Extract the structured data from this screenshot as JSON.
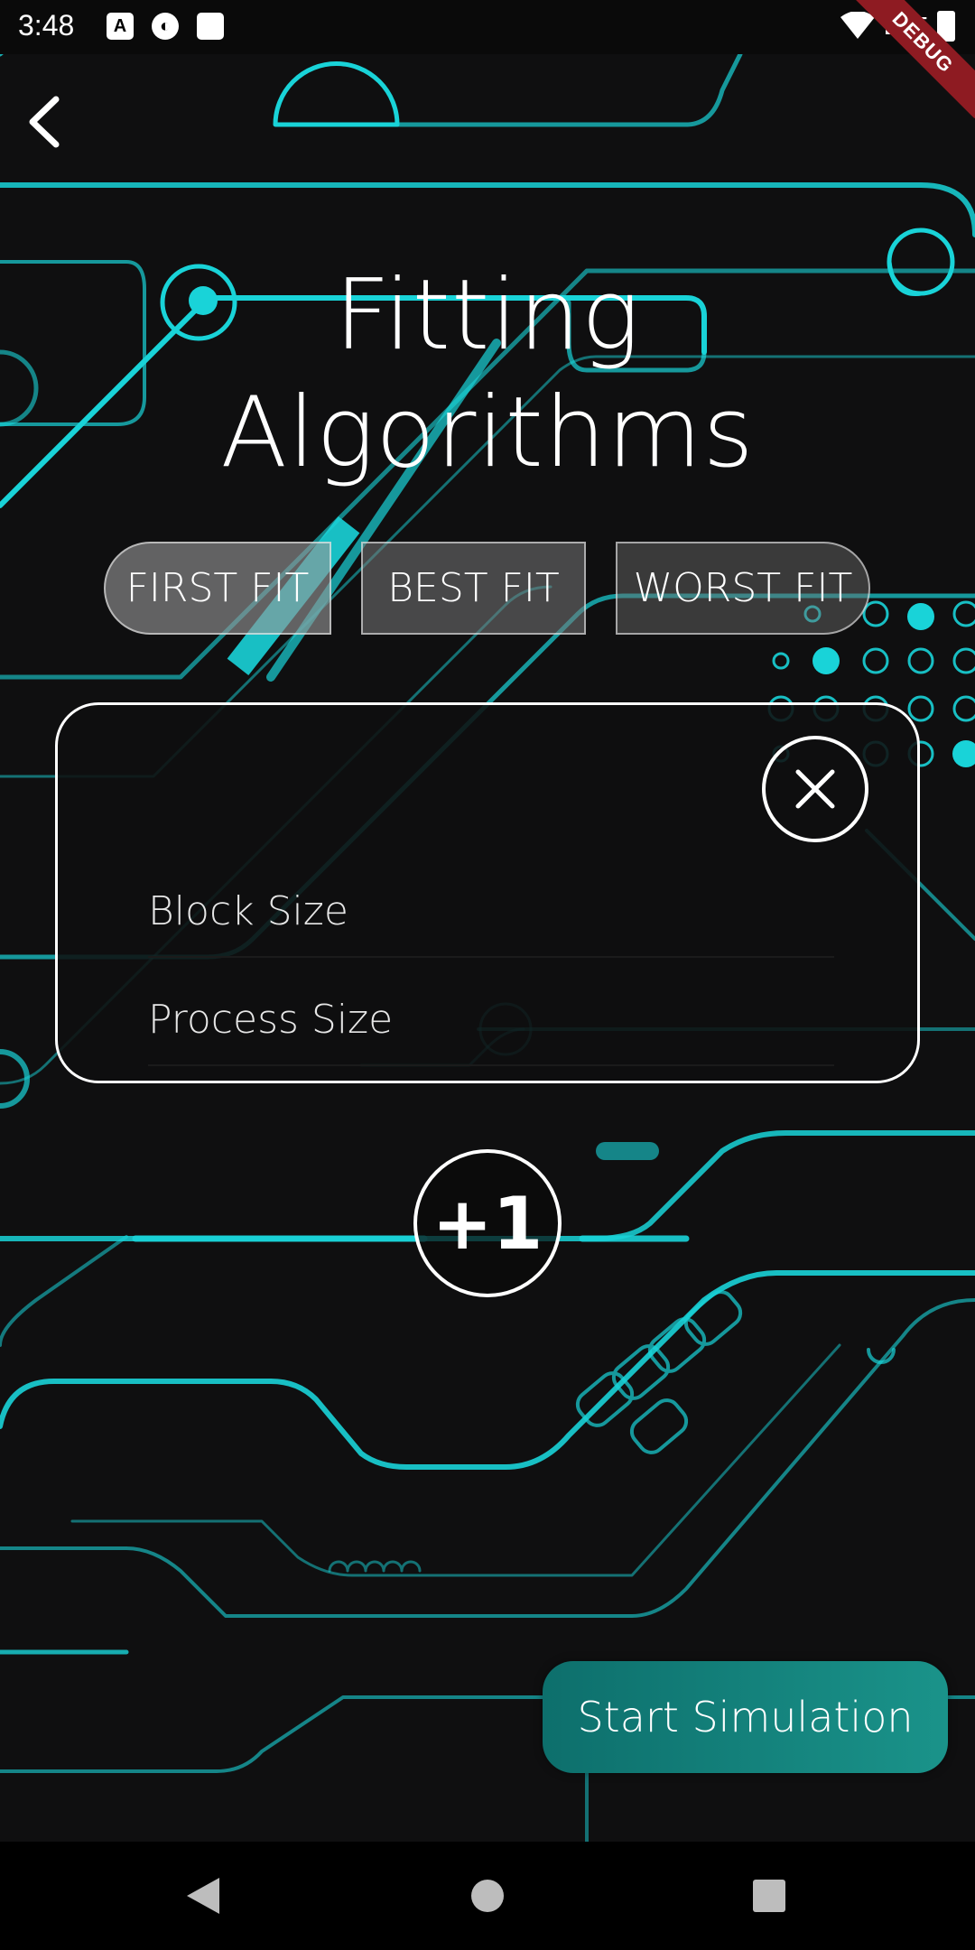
{
  "status_bar": {
    "time": "3:48",
    "network": "LTE",
    "icons": [
      "a-box-icon",
      "face-circle-icon",
      "sd-card-icon",
      "wifi-icon",
      "battery-icon"
    ]
  },
  "debug_banner": "DEBUG",
  "colors": {
    "background": "#0f0f10",
    "circuit": "#19d3d8",
    "accent_button": "#15837d",
    "debug_ribbon": "#8e1b22"
  },
  "header": {
    "title_line1": "Fitting",
    "title_line2": "Algorithms"
  },
  "algorithms": {
    "first_fit": "FIRST FIT",
    "best_fit": "BEST FIT",
    "worst_fit": "WORST FIT"
  },
  "entry_card": {
    "block_size_placeholder": "Block Size",
    "process_size_placeholder": "Process Size"
  },
  "add_button_label": "+1",
  "start_button_label": "Start Simulation"
}
